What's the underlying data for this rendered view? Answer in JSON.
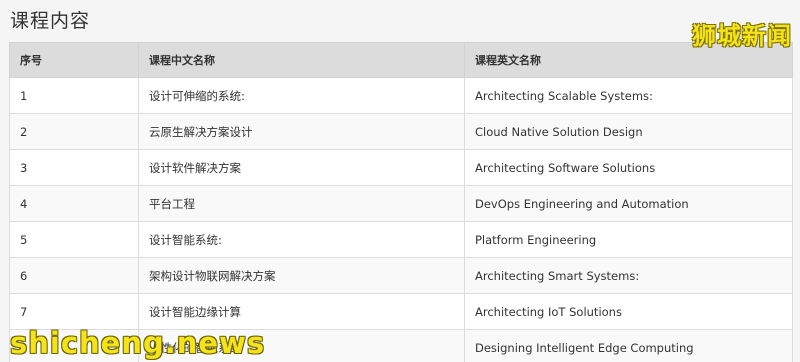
{
  "page": {
    "title": "课程内容"
  },
  "table": {
    "headers": {
      "num": "序号",
      "cn": "课程中文名称",
      "en": "课程英文名称"
    },
    "rows": [
      {
        "num": "1",
        "cn": "设计可伸缩的系统:",
        "en": "Architecting Scalable Systems:"
      },
      {
        "num": "2",
        "cn": "云原生解决方案设计",
        "en": "Cloud Native Solution Design"
      },
      {
        "num": "3",
        "cn": "设计软件解决方案",
        "en": "Architecting Software Solutions"
      },
      {
        "num": "4",
        "cn": "平台工程",
        "en": "DevOps Engineering and Automation"
      },
      {
        "num": "5",
        "cn": "设计智能系统:",
        "en": "Platform Engineering"
      },
      {
        "num": "6",
        "cn": "架构设计物联网解决方案",
        "en": "Architecting Smart Systems:"
      },
      {
        "num": "7",
        "cn": "设计智能边缘计算",
        "en": "Architecting IoT Solutions"
      },
      {
        "num": "8",
        "cn": "人性化的智能系统",
        "en": "Designing Intelligent Edge Computing"
      }
    ]
  },
  "watermark": {
    "top": "狮城新闻",
    "bottom": "shicheng.news",
    "color": "#f4e21a"
  }
}
